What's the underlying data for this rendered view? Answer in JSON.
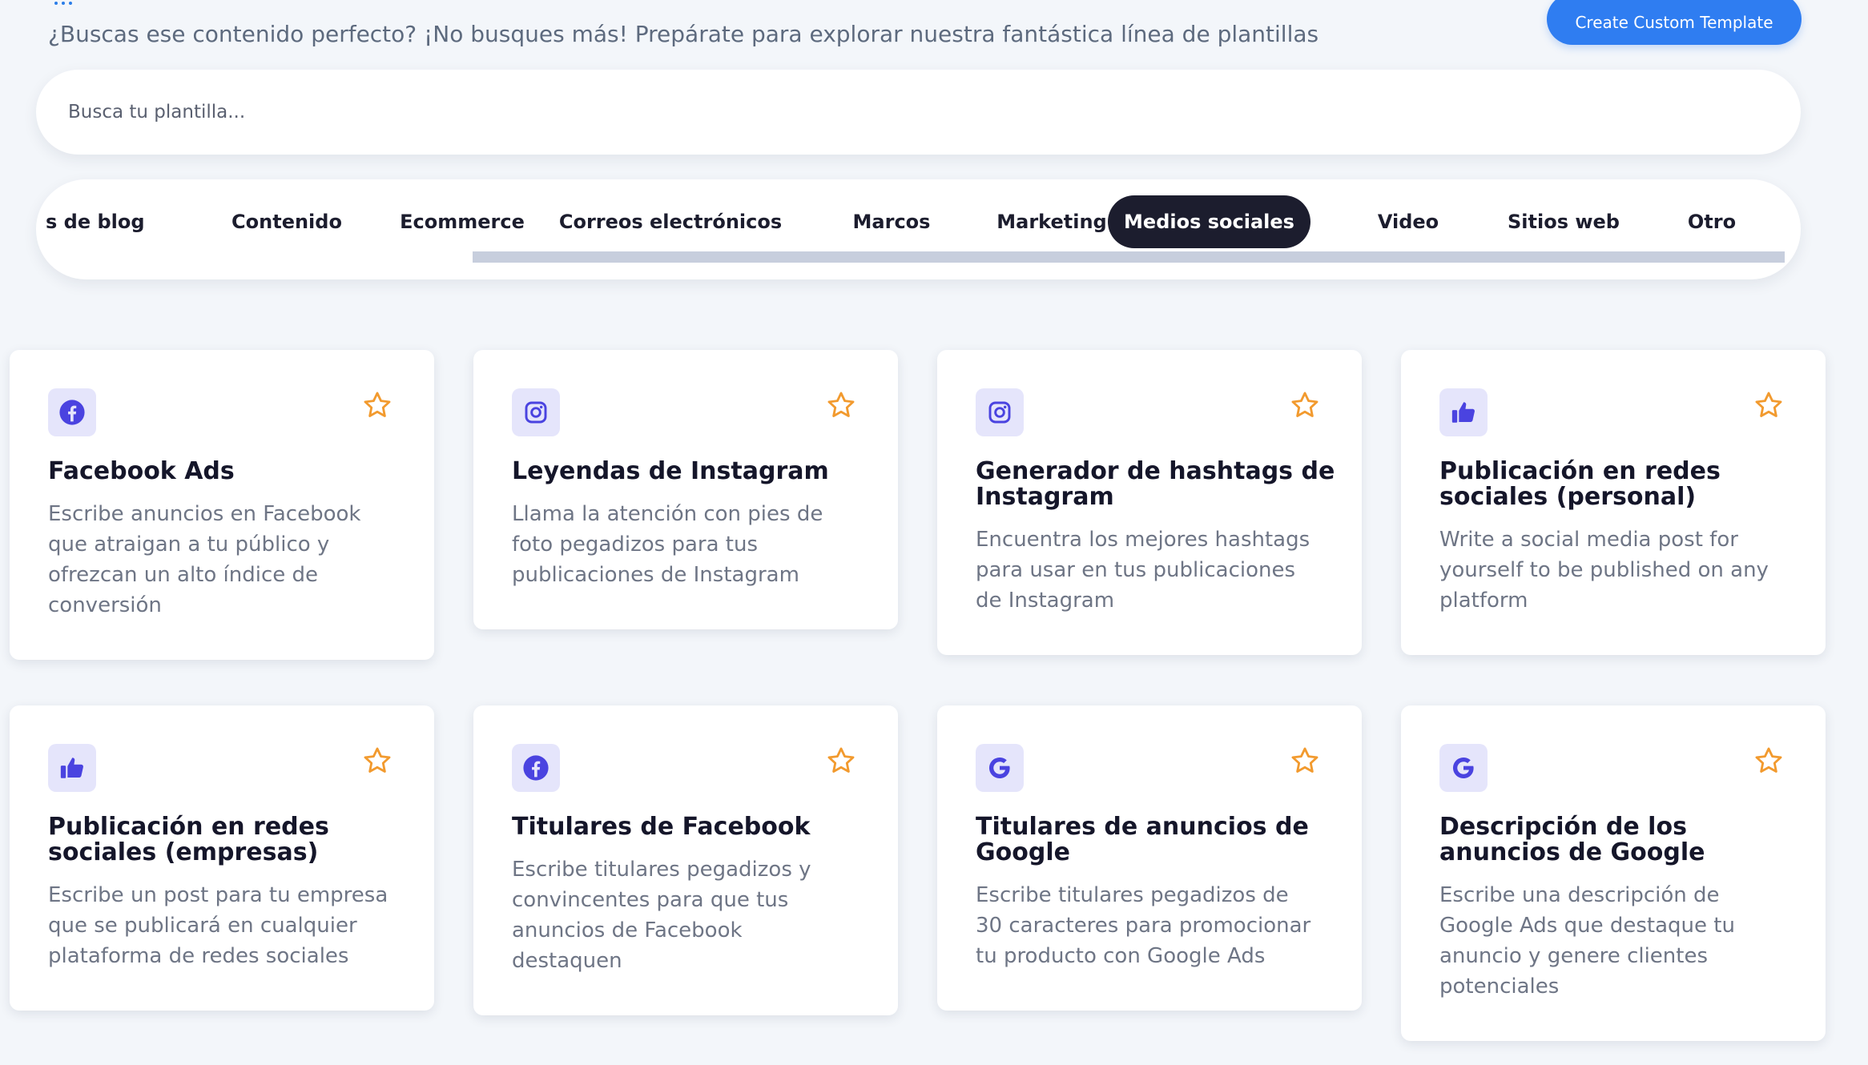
{
  "header": {
    "subtitle": "¿Buscas ese contenido perfecto? ¡No busques más! Prepárate para explorar nuestra fantástica línea de plantillas",
    "create_button": "Create Custom Template"
  },
  "search": {
    "placeholder": "Busca tu plantilla..."
  },
  "tabs": [
    {
      "label": "s de blog"
    },
    {
      "label": "Contenido"
    },
    {
      "label": "Ecommerce"
    },
    {
      "label": "Correos electrónicos"
    },
    {
      "label": "Marcos"
    },
    {
      "label": "Marketing"
    },
    {
      "label": "Medios sociales",
      "active": true
    },
    {
      "label": "Video"
    },
    {
      "label": "Sitios web"
    },
    {
      "label": "Otro"
    }
  ],
  "cards": [
    {
      "icon": "facebook-icon",
      "title": "Facebook Ads",
      "description": "Escribe anuncios en Facebook que atraigan a tu público y ofrezcan un alto índice de conversión"
    },
    {
      "icon": "instagram-icon",
      "title": "Leyendas de Instagram",
      "description": "Llama la atención con pies de foto pegadizos para tus publicaciones de Instagram"
    },
    {
      "icon": "instagram-icon",
      "title": "Generador de hashtags de Instagram",
      "description": "Encuentra los mejores hashtags para usar en tus publicaciones de Instagram"
    },
    {
      "icon": "thumbs-up-icon",
      "title": "Publicación en redes sociales (personal)",
      "description": "Write a social media post for yourself to be published on any platform"
    },
    {
      "icon": "thumbs-up-icon",
      "title": "Publicación en redes sociales (empresas)",
      "description": "Escribe un post para tu empresa que se publicará en cualquier plataforma de redes sociales"
    },
    {
      "icon": "facebook-icon",
      "title": "Titulares de Facebook",
      "description": "Escribe titulares pegadizos y convincentes para que tus anuncios de Facebook destaquen"
    },
    {
      "icon": "google-icon",
      "title": "Titulares de anuncios de Google",
      "description": "Escribe titulares pegadizos de 30 caracteres para promocionar tu producto con Google Ads"
    },
    {
      "icon": "google-icon",
      "title": "Descripción de los anuncios de Google",
      "description": "Escribe una descripción de Google Ads que destaque tu anuncio y genere clientes potenciales"
    }
  ],
  "colors": {
    "accent": "#2f7df1",
    "active_tab": "#1c1d2e",
    "icon_bg": "#e5e5fb",
    "icon": "#4a43e0",
    "star": "#f29a2e",
    "background": "#f3f6fa"
  }
}
